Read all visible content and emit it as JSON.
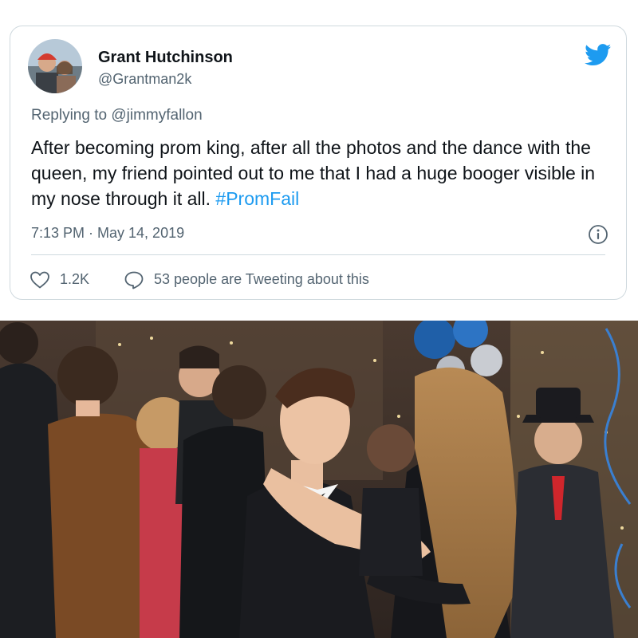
{
  "tweet": {
    "author_name": "Grant Hutchinson",
    "author_handle": "@Grantman2k",
    "reply_prefix": "Replying to",
    "reply_mention": "@jimmyfallon",
    "text": "After becoming prom king, after all the photos and the dance with the queen, my friend pointed out to me that I had a huge booger visible in my nose through it all.",
    "hashtag": "#PromFail",
    "timestamp": "7:13 PM · May 14, 2019",
    "like_count": "1.2K",
    "tweeting_about": "53 people are Tweeting about this"
  },
  "colors": {
    "brand": "#1d9bf0",
    "text_primary": "#0f1419",
    "text_secondary": "#536471",
    "border": "#cfd9de"
  },
  "icons": {
    "avatar": "avatar",
    "brand": "twitter-bird-icon",
    "info": "info-icon",
    "like": "heart-icon",
    "reply": "speech-bubble-icon"
  }
}
